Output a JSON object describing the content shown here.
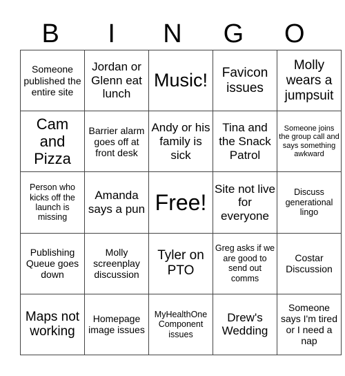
{
  "title_letters": [
    "B",
    "I",
    "N",
    "G",
    "O"
  ],
  "rows": [
    [
      "Someone published the entire site",
      "Jordan or Glenn eat lunch",
      "Music!",
      "Favicon issues",
      "Molly wears a jumpsuit"
    ],
    [
      "Cam and Pizza",
      "Barrier alarm goes off at front desk",
      "Andy or his family is sick",
      "Tina and the Snack Patrol",
      "Someone joins the group call and says something awkward"
    ],
    [
      "Person who kicks off the launch is missing",
      "Amanda says a pun",
      "Free!",
      "Site not live for everyone",
      "Discuss generational lingo"
    ],
    [
      "Publishing Queue goes down",
      "Molly screenplay discussion",
      "Tyler on PTO",
      "Greg asks if we are good to send out comms",
      "Costar Discussion"
    ],
    [
      "Maps not working",
      "Homepage image issues",
      "MyHealthOne Component issues",
      "Drew's Wedding",
      "Someone says I'm tired or I need a nap"
    ]
  ]
}
